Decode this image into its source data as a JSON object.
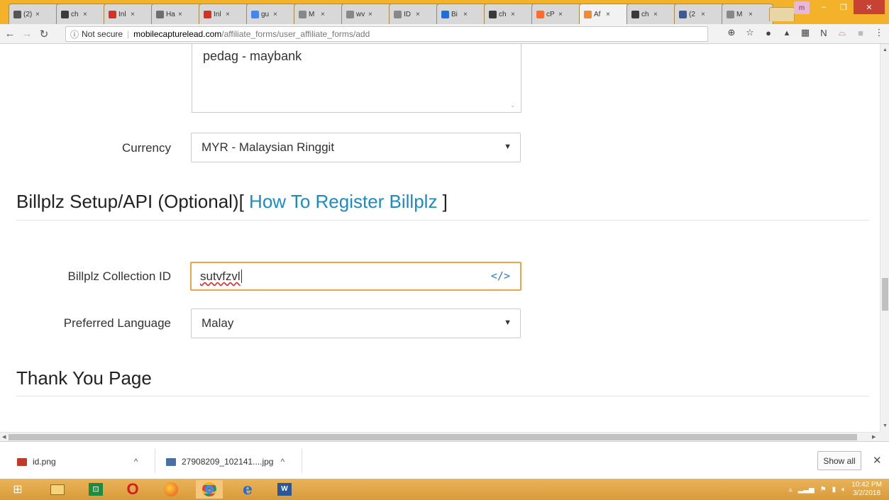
{
  "browser": {
    "tabs": [
      {
        "label": "(2)",
        "color": "#555555"
      },
      {
        "label": "ch",
        "color": "#3a3a3a"
      },
      {
        "label": "Inl",
        "color": "#d93025"
      },
      {
        "label": "Ha",
        "color": "#6e6e6e"
      },
      {
        "label": "Inl",
        "color": "#d93025"
      },
      {
        "label": "gu",
        "color": "#4285f4"
      },
      {
        "label": "M",
        "color": "#888888"
      },
      {
        "label": "wv",
        "color": "#888888"
      },
      {
        "label": "ID",
        "color": "#888888"
      },
      {
        "label": "Bi",
        "color": "#1e6fd9"
      },
      {
        "label": "ch",
        "color": "#3a3a3a"
      },
      {
        "label": "cP",
        "color": "#ff6c2c"
      },
      {
        "label": "Af",
        "color": "#f28a30",
        "active": true
      },
      {
        "label": "ch",
        "color": "#3a3a3a"
      },
      {
        "label": "(2",
        "color": "#3b5998"
      },
      {
        "label": "M",
        "color": "#888888"
      }
    ],
    "url": {
      "security": "Not secure",
      "host": "mobilecapturelead.com",
      "path": "/affiliate_forms/user_affiliate_forms/add"
    },
    "profile_initial": "m"
  },
  "form": {
    "bank_text": "pedag - maybank",
    "currency": {
      "label": "Currency",
      "value": "MYR - Malaysian Ringgit"
    },
    "billplz_section": {
      "title": "Billplz Setup/API (Optional)[ ",
      "link": "How To Register Billplz",
      "suffix": " ]"
    },
    "collection_id": {
      "label": "Billplz Collection ID",
      "value": "sutvfzvl"
    },
    "language": {
      "label": "Preferred Language",
      "value": "Malay"
    },
    "thank_you_section": {
      "title": "Thank You Page"
    }
  },
  "downloads": {
    "items": [
      {
        "name": "id.png"
      },
      {
        "name": "27908209_102141....jpg"
      }
    ],
    "show_all": "Show all"
  },
  "taskbar": {
    "time": "10:42 PM",
    "date": "3/2/2018"
  }
}
